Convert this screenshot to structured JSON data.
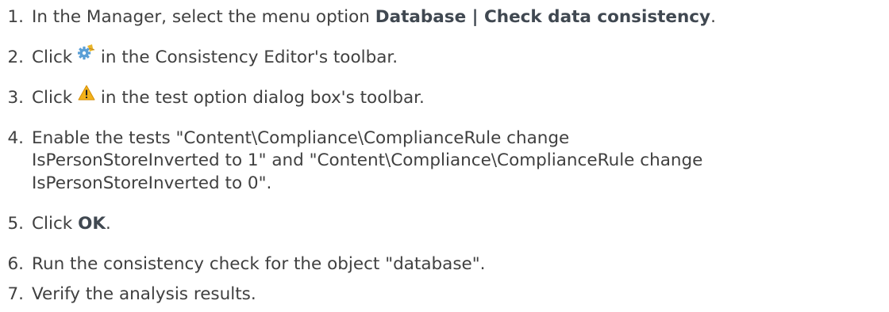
{
  "steps": [
    {
      "number": "1.",
      "pre": "In the Manager, select the menu option ",
      "bold": "Database | Check data consistency",
      "post": "."
    },
    {
      "number": "2.",
      "pre": "Click ",
      "icon": "gear-settings-icon",
      "post": " in the Consistency Editor's toolbar."
    },
    {
      "number": "3.",
      "pre": "Click ",
      "icon": "warning-icon",
      "post": " in the test option dialog box's toolbar."
    },
    {
      "number": "4.",
      "line1": "Enable the tests \"Content\\Compliance\\ComplianceRule change",
      "line2": "IsPersonStoreInverted to 1\" and \"Content\\Compliance\\ComplianceRule change",
      "line3": "IsPersonStoreInverted to 0\"."
    },
    {
      "number": "5.",
      "pre": "Click ",
      "bold": "OK",
      "post": "."
    },
    {
      "number": "6.",
      "text": "Run the consistency check for the object \"database\"."
    },
    {
      "number": "7.",
      "text": "Verify the analysis results."
    }
  ]
}
